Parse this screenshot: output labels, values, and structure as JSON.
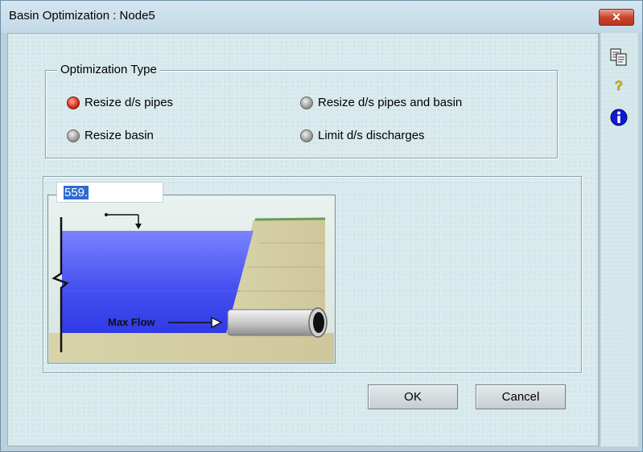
{
  "window": {
    "title": "Basin Optimization : Node5",
    "close_label": "✕"
  },
  "optimization": {
    "legend": "Optimization Type",
    "options": [
      {
        "label": "Resize d/s pipes",
        "checked": true
      },
      {
        "label": "Resize d/s pipes and basin",
        "checked": false
      },
      {
        "label": "Resize basin",
        "checked": false
      },
      {
        "label": "Limit d/s discharges",
        "checked": false
      }
    ]
  },
  "diagram": {
    "value": "559.",
    "max_flow_label": "Max Flow"
  },
  "buttons": {
    "ok": "OK",
    "cancel": "Cancel"
  },
  "side_icons": [
    "copy-icon",
    "help-icon",
    "info-icon"
  ],
  "colors": {
    "accent_red": "#d9321d",
    "water": "#3d46ee",
    "selection": "#2f6ad0"
  }
}
